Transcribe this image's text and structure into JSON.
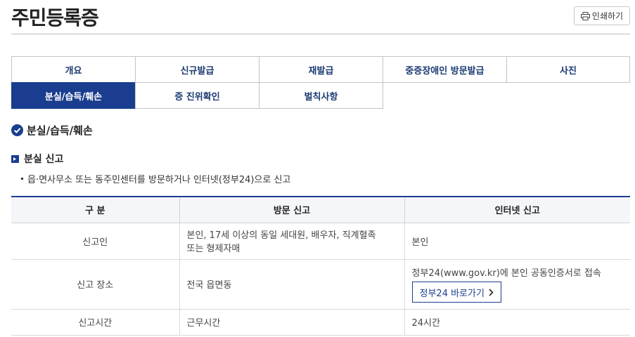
{
  "page": {
    "title": "주민등록증",
    "print_label": "인쇄하기"
  },
  "tabs": [
    {
      "label": "개요",
      "active": false
    },
    {
      "label": "신규발급",
      "active": false
    },
    {
      "label": "재발급",
      "active": false
    },
    {
      "label": "중증장애인 방문발급",
      "active": false
    },
    {
      "label": "사진",
      "active": false
    },
    {
      "label": "분실/습득/훼손",
      "active": true
    },
    {
      "label": "증 진위확인",
      "active": false
    },
    {
      "label": "벌칙사항",
      "active": false
    }
  ],
  "section": {
    "heading": "분실/습득/훼손"
  },
  "subsection": {
    "heading": "분실 신고",
    "bullet": "읍·면사무소 또는 동주민센터를 방문하거나 인터넷(정부24)으로 신고"
  },
  "table": {
    "headers": [
      "구 분",
      "방문 신고",
      "인터넷 신고"
    ],
    "rows": [
      {
        "label": "신고인",
        "visit_line1": "본인, 17세 이상의 동일 세대원, 배우자, 직계혈족",
        "visit_line2": "또는 형제자매",
        "internet": "본인"
      },
      {
        "label": "신고 장소",
        "visit": "전국 읍면동",
        "internet": "정부24(www.gov.kr)에 본인 공동인증서로 접속",
        "link_label": "정부24 바로가기"
      },
      {
        "label": "신고시간",
        "visit": "근무시간",
        "internet": "24시간"
      }
    ]
  },
  "colors": {
    "primary": "#1b3d8f",
    "header_bg": "#f4f6f9"
  }
}
